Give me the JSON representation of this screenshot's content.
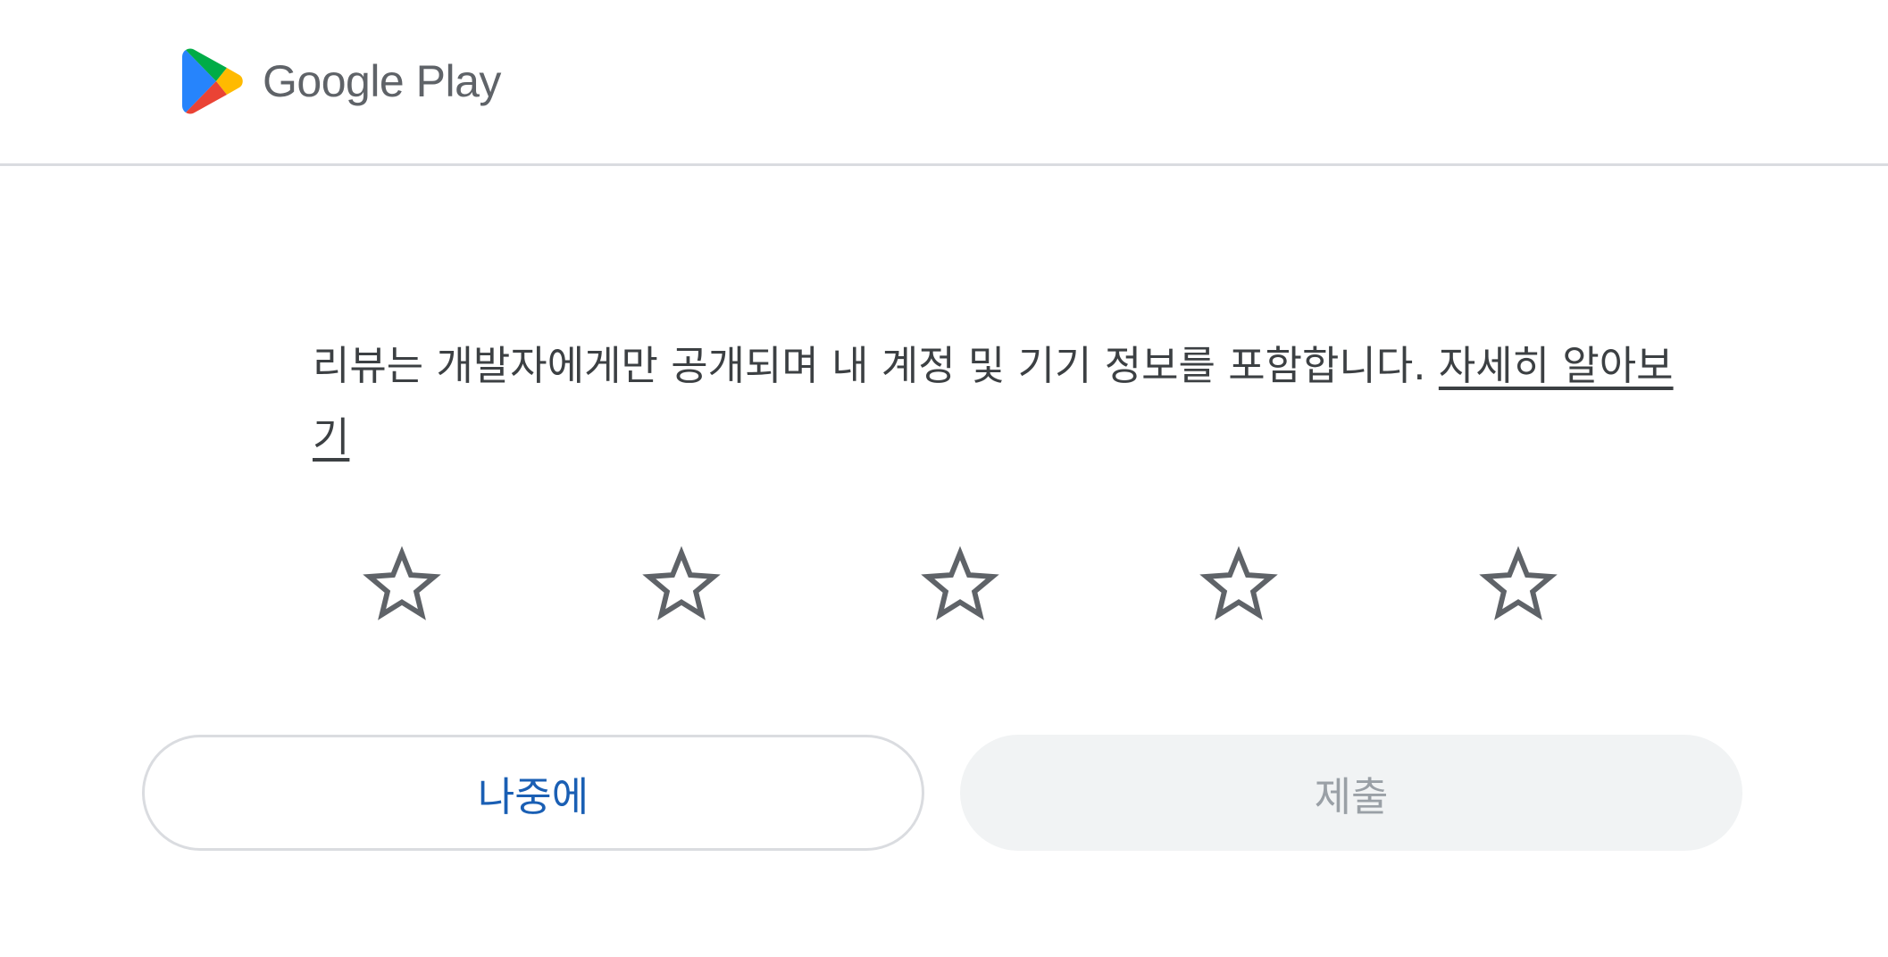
{
  "header": {
    "brand": "Google Play",
    "logo_icon": "google-play-triangle-icon"
  },
  "notice": {
    "text": "리뷰는 개발자에게만 공개되며 내 계정 및 기기 정보를 포함합니다. ",
    "link_text": "자세히 알아보기"
  },
  "rating": {
    "star_icon": "star-outline-icon",
    "max_stars": 5,
    "selected": 0,
    "star_color": "#5f6368"
  },
  "actions": {
    "later_label": "나중에",
    "submit_label": "제출"
  },
  "colors": {
    "later_text": "#1a5fb4",
    "submit_bg": "#f1f3f4",
    "submit_text": "#9aa0a6"
  }
}
